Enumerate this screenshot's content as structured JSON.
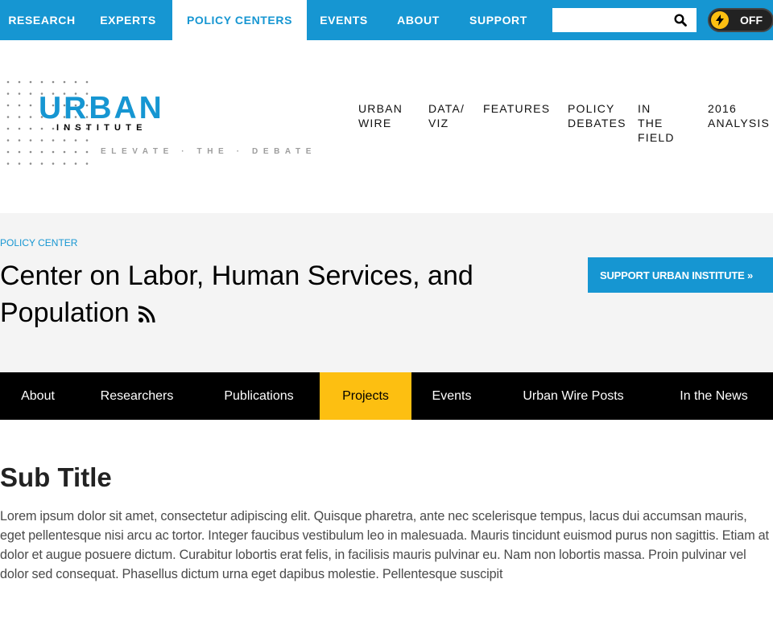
{
  "top_nav": {
    "items": [
      {
        "label": "RESEARCH",
        "active": false
      },
      {
        "label": "EXPERTS",
        "active": false
      },
      {
        "label": "POLICY CENTERS",
        "active": true
      },
      {
        "label": "EVENTS",
        "active": false
      },
      {
        "label": "ABOUT",
        "active": false
      },
      {
        "label": "SUPPORT",
        "active": false
      }
    ],
    "search": {
      "value": "",
      "placeholder": "",
      "icon": "search-icon"
    },
    "toggle": {
      "label": "OFF",
      "icon": "lightning-bolt-icon"
    }
  },
  "logo": {
    "word": "URBAN",
    "sub": "INSTITUTE",
    "tagline": "ELEVATE · THE · DEBATE"
  },
  "main_nav": {
    "items": [
      {
        "label": "URBAN\nWIRE"
      },
      {
        "label": "DATA/\nVIZ"
      },
      {
        "label": "FEATURES"
      },
      {
        "label": "POLICY\nDEBATES"
      },
      {
        "label": "IN THE\nFIELD"
      },
      {
        "label": "2016\nANALYSIS"
      }
    ]
  },
  "hero": {
    "eyebrow": "POLICY CENTER",
    "title": "Center on Labor, Human Services, and Population",
    "rss_icon": "rss-icon",
    "support_button": "SUPPORT URBAN INSTITUTE »"
  },
  "tabs": [
    {
      "label": "About",
      "active": false
    },
    {
      "label": "Researchers",
      "active": false
    },
    {
      "label": "Publications",
      "active": false
    },
    {
      "label": "Projects",
      "active": true
    },
    {
      "label": "Events",
      "active": false
    },
    {
      "label": "Urban Wire Posts",
      "active": false
    },
    {
      "label": "In the News",
      "active": false
    }
  ],
  "content": {
    "sub_title": "Sub Title",
    "paragraph": "Lorem ipsum dolor sit amet, consectetur adipiscing elit. Quisque pharetra, ante nec scelerisque tempus, lacus dui accumsan mauris, eget pellentesque nisi arcu ac tortor. Integer faucibus vestibulum leo in malesuada. Mauris tincidunt euismod purus non sagittis. Etiam at dolor et augue posuere dictum. Curabitur lobortis erat felis, in facilisis mauris pulvinar eu. Nam non lobortis massa. Proin pulvinar vel dolor sed consequat. Phasellus dictum urna eget dapibus molestie. Pellentesque suscipit"
  },
  "colors": {
    "brand_blue": "#1696d2",
    "accent_yellow": "#fdbf11",
    "tabs_background": "#000000",
    "band_background": "#f4f4f4"
  }
}
